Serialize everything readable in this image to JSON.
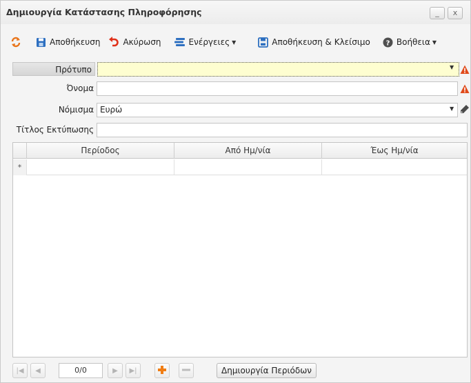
{
  "window": {
    "title": "Δημιουργία Κατάστασης Πληροφόρησης",
    "minimize_glyph": "_",
    "close_glyph": "x"
  },
  "toolbar": {
    "refresh_icon": "refresh-icon",
    "save_label": "Αποθήκευση",
    "cancel_label": "Ακύρωση",
    "actions_label": "Ενέργειες",
    "save_close_label": "Αποθήκευση & Κλείσιμο",
    "help_label": "Βοήθεια"
  },
  "form": {
    "template_label": "Πρότυπο",
    "template_value": "",
    "name_label": "Όνομα",
    "name_value": "",
    "currency_label": "Νόμισμα",
    "currency_value": "Ευρώ",
    "print_title_label": "Τίτλος Εκτύπωσης",
    "print_title_value": ""
  },
  "grid": {
    "columns": [
      "Περίοδος",
      "Από Ημ/νία",
      "Έως Ημ/νία"
    ],
    "new_row_marker": "*"
  },
  "pager": {
    "page_value": "0/0",
    "create_periods_label": "Δημιουργία Περιόδων"
  },
  "colors": {
    "required_highlight": "#fefed0",
    "warning": "#e04a1a",
    "add_button": "#f07d14",
    "icon_blue": "#2d6fc0"
  }
}
